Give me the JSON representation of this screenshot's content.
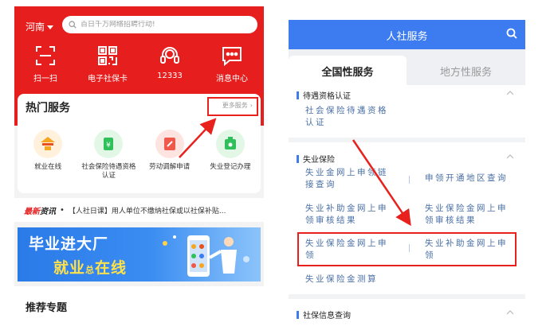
{
  "left": {
    "region": "河南",
    "search_placeholder": "百日千万网络招聘行动!",
    "quick_icons": [
      {
        "icon": "scan-icon",
        "label": "扫一扫"
      },
      {
        "icon": "qr-card-icon",
        "label": "电子社保卡"
      },
      {
        "icon": "headset-icon",
        "label": "12333"
      },
      {
        "icon": "message-icon",
        "label": "消息中心"
      }
    ],
    "hot_title": "热门服务",
    "more_label": "更多服务",
    "hot_items": [
      {
        "icon": "employment-icon",
        "label": "就业在线",
        "bg": "#fff1dc"
      },
      {
        "icon": "insurance-icon",
        "label": "社会保险待遇资格\n认证",
        "bg": "#e3f7e7"
      },
      {
        "icon": "mediation-icon",
        "label": "劳动调解申请",
        "bg": "#fde4e1"
      },
      {
        "icon": "unemployment-icon",
        "label": "失业登记办理",
        "bg": "#e3f7e7"
      }
    ],
    "news_tag_a": "最新",
    "news_tag_b": "资讯",
    "news_text": "【人社日课】用人单位不缴纳社保或以社保补贴...",
    "banner_line1": "毕业进大厂",
    "banner_line2a": "就业",
    "banner_line2b": "总",
    "banner_line2c": "在线",
    "recommend_title": "推荐专题",
    "colors": {
      "brand_red": "#e61e1e",
      "highlight": "#e8211d"
    }
  },
  "right": {
    "title": "人社服务",
    "tabs": [
      "全国性服务",
      "地方性服务"
    ],
    "sections": [
      {
        "title": "待遇资格认证",
        "items": [
          "社会保险待遇资格\n认证"
        ]
      },
      {
        "title": "失业保险",
        "items": [
          "失业金网上申领链\n接查询",
          "申领开通地区查询",
          "失业补助金网上申\n领审核结果",
          "失业保险金网上申\n领审核结果",
          "失业保险金网上申\n领",
          "失业补助金网上申\n领",
          "失业保险金测算"
        ]
      },
      {
        "title": "社保信息查询",
        "items": []
      }
    ],
    "colors": {
      "header_blue": "#3d7cf0",
      "link_blue": "#4a6fa5"
    }
  }
}
